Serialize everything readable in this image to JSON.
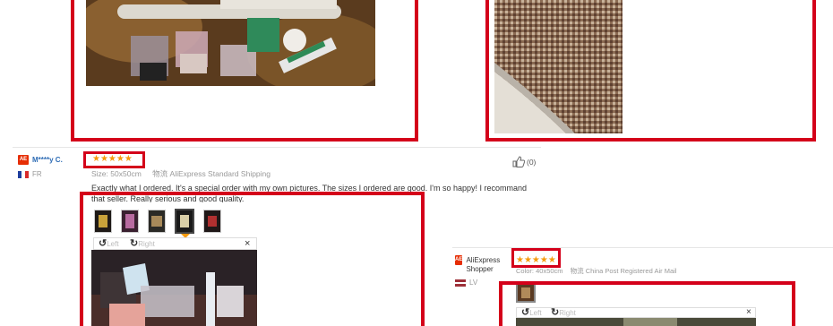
{
  "reviews": [
    {
      "buyer": "M****y C.",
      "country": "FR",
      "stars": "★★★★★",
      "size_label": "Size:",
      "size_value": "50x50cm",
      "shipping_prefix": "物流",
      "shipping": "AliExpress Standard Shipping",
      "helpful": "(0)",
      "text": "Exactly what I ordered. It's a special order with my own pictures. The sizes I ordered are good. I'm so happy! I recommand that seller. Really serious and good quality."
    },
    {
      "buyer": "AliExpress Shopper",
      "country": "LV",
      "stars": "★★★★★",
      "color_label": "Color:",
      "color_value": "40x50cm",
      "shipping_prefix": "物流",
      "shipping": "China Post Registered Air Mail"
    }
  ],
  "viewer": {
    "left_label": "Left",
    "right_label": "Right",
    "close": "×"
  },
  "badges": {
    "aliexpress": "AE"
  },
  "colors": {
    "highlight": "#d4001a",
    "star": "#f59a0d",
    "link": "#2e6cb5"
  }
}
